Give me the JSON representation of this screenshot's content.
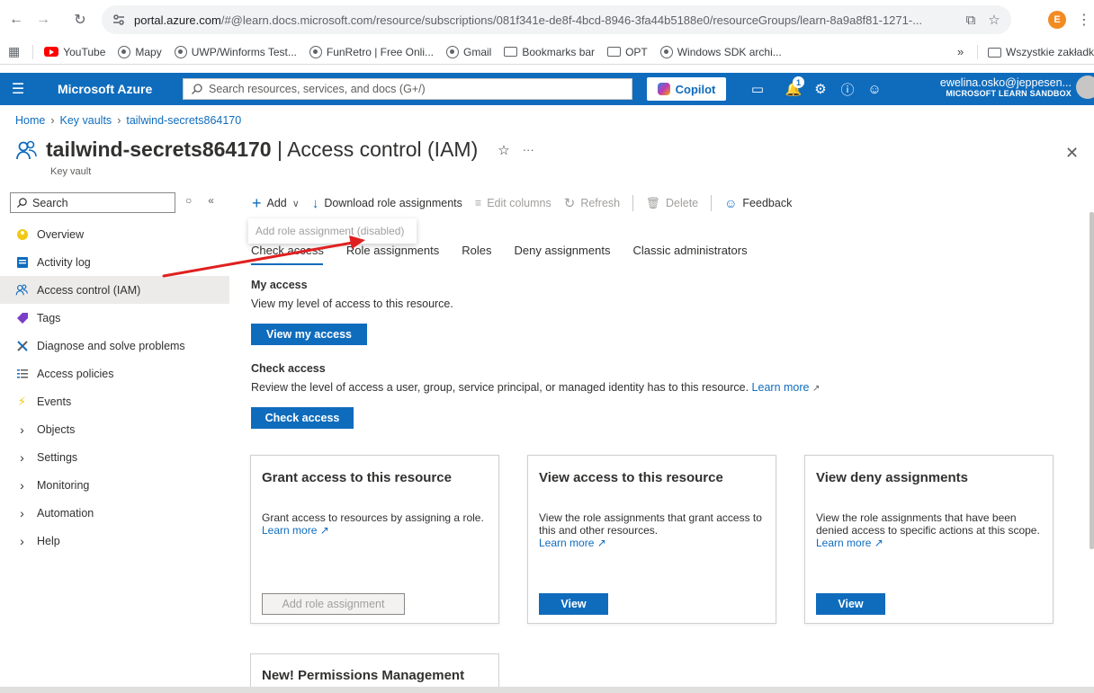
{
  "browser": {
    "url_main": "portal.azure.com",
    "url_rest": "/#@learn.docs.microsoft.com/resource/subscriptions/081f341e-de8f-4bcd-8946-3fa44b5188e0/resourceGroups/learn-8a9a8f81-1271-...",
    "profile_initial": "E",
    "bookmarks": [
      "YouTube",
      "Mapy",
      "UWP/Winforms Test...",
      "FunRetro | Free Onli...",
      "Gmail",
      "Bookmarks bar",
      "OPT",
      "Windows SDK archi..."
    ],
    "overflow": "»",
    "all_bookmarks": "Wszystkie zakładki"
  },
  "azure": {
    "brand": "Microsoft Azure",
    "search_placeholder": "Search resources, services, and docs (G+/)",
    "copilot": "Copilot",
    "notif_count": "1",
    "email": "ewelina.osko@jeppesen...",
    "tenant": "MICROSOFT LEARN SANDBOX"
  },
  "breadcrumb": [
    "Home",
    "Key vaults",
    "tailwind-secrets864170"
  ],
  "title": {
    "resource": "tailwind-secrets864170",
    "rest": " | Access control (IAM)",
    "subtitle": "Key vault"
  },
  "menu": {
    "search": "Search",
    "items": [
      {
        "label": "Overview",
        "icon": "overview-icon",
        "selected": false
      },
      {
        "label": "Activity log",
        "icon": "activity-log-icon",
        "selected": false
      },
      {
        "label": "Access control (IAM)",
        "icon": "iam-icon",
        "selected": true
      },
      {
        "label": "Tags",
        "icon": "tag-icon",
        "selected": false
      },
      {
        "label": "Diagnose and solve problems",
        "icon": "wrench-icon",
        "selected": false
      },
      {
        "label": "Access policies",
        "icon": "policies-icon",
        "selected": false
      },
      {
        "label": "Events",
        "icon": "lightning-icon",
        "selected": false
      },
      {
        "label": "Objects",
        "icon": "chevron-right-icon",
        "selected": false
      },
      {
        "label": "Settings",
        "icon": "chevron-right-icon",
        "selected": false
      },
      {
        "label": "Monitoring",
        "icon": "chevron-right-icon",
        "selected": false
      },
      {
        "label": "Automation",
        "icon": "chevron-right-icon",
        "selected": false
      },
      {
        "label": "Help",
        "icon": "chevron-right-icon",
        "selected": false
      }
    ]
  },
  "toolbar": {
    "add": "Add",
    "download": "Download role assignments",
    "edit_columns": "Edit columns",
    "refresh": "Refresh",
    "delete": "Delete",
    "feedback": "Feedback",
    "tooltip": "Add role assignment (disabled)"
  },
  "tabs": [
    "Check access",
    "Role assignments",
    "Roles",
    "Deny assignments",
    "Classic administrators"
  ],
  "my_access": {
    "heading": "My access",
    "text": "View my level of access to this resource.",
    "button": "View my access"
  },
  "check_access": {
    "heading": "Check access",
    "text": "Review the level of access a user, group, service principal, or managed identity has to this resource.",
    "link": "Learn more",
    "button": "Check access"
  },
  "cards": [
    {
      "title": "Grant access to this resource",
      "text": "Grant access to resources by assigning a role.",
      "link": "Learn more",
      "button": "Add role assignment"
    },
    {
      "title": "View access to this resource",
      "text": "View the role assignments that grant access to this and other resources.",
      "link": "Learn more",
      "button": "View"
    },
    {
      "title": "View deny assignments",
      "text": "View the role assignments that have been denied access to specific actions at this scope.",
      "link": "Learn more",
      "button": "View"
    },
    {
      "title": "New! Permissions Management"
    }
  ],
  "colors": {
    "accent": "#0f6cbd",
    "annotation_arrow": "#e02020"
  }
}
